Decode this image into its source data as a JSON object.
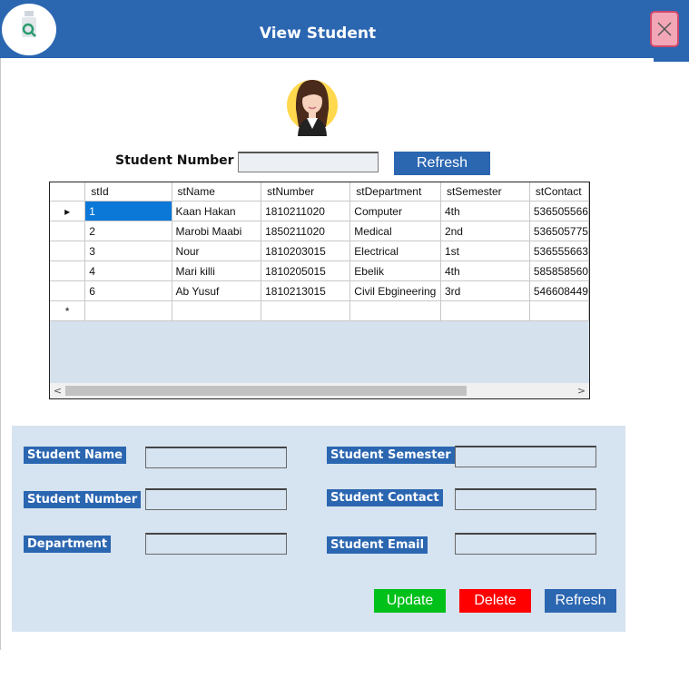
{
  "header": {
    "title": "View Student",
    "logo_icon": "student-search-icon",
    "close_icon": "close-icon"
  },
  "colors": {
    "brand": "#2b66b1",
    "panel": "#d6e3f0",
    "update": "#00c01a",
    "delete": "#ff0000",
    "selection": "#0b78d7"
  },
  "search": {
    "label": "Student Number",
    "value": "",
    "refresh_label": "Refresh"
  },
  "grid": {
    "columns": [
      "stId",
      "stName",
      "stNumber",
      "stDepartment",
      "stSemester",
      "stContact"
    ],
    "rows": [
      [
        "1",
        "Kaan Hakan",
        "1810211020",
        "Computer",
        "4th",
        "536505566"
      ],
      [
        "2",
        "Marobi Maabi",
        "1850211020",
        "Medical",
        "2nd",
        "536505775"
      ],
      [
        "3",
        "Nour",
        "1810203015",
        "Electrical",
        "1st",
        "536555663"
      ],
      [
        "4",
        "Mari killi",
        "1810205015",
        "Ebelik",
        "4th",
        "585858560"
      ],
      [
        "6",
        "Ab Yusuf",
        "1810213015",
        "Civil Ebgineering",
        "3rd",
        "546608449"
      ]
    ],
    "current_row_marker": "▸",
    "new_row_marker": "*"
  },
  "form": {
    "student_name_label": "Student Name",
    "student_number_label": "Student Number",
    "department_label": "Department",
    "student_semester_label": "Student Semester",
    "student_contact_label": "Student Contact",
    "student_email_label": "Student Email",
    "student_name_value": "",
    "student_number_value": "",
    "department_value": "",
    "student_semester_value": "",
    "student_contact_value": "",
    "student_email_value": ""
  },
  "actions": {
    "update_label": "Update",
    "delete_label": "Delete",
    "refresh_label": "Refresh"
  }
}
